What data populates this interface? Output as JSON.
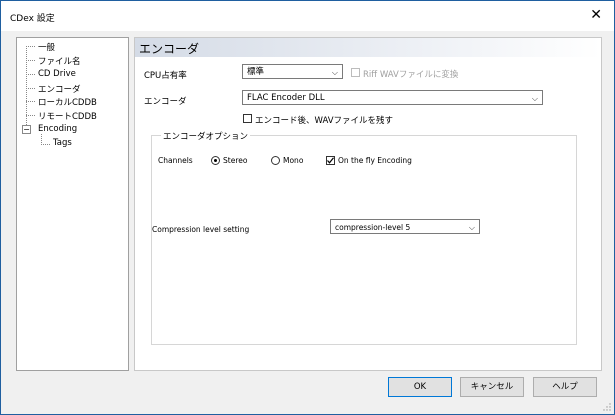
{
  "window": {
    "title": "CDex 設定",
    "close_glyph": "✕"
  },
  "tree": {
    "items": [
      "一般",
      "ファイル名",
      "CD Drive",
      "エンコーダ",
      "ローカルCDDB",
      "リモートCDDB",
      "Encoding"
    ],
    "children": [
      "Tags"
    ],
    "expander": "−"
  },
  "panel": {
    "title": "エンコーダ",
    "cpu_label": "CPU占有率",
    "cpu_value": "標準",
    "riff_label": "Riff WAVファイルに変換",
    "encoder_label": "エンコーダ",
    "encoder_value": "FLAC Encoder DLL",
    "keep_wav_label": "エンコード後、WAVファイルを残す",
    "options_group": "エンコーダオプション",
    "channels_label": "Channels",
    "stereo_label": "Stereo",
    "mono_label": "Mono",
    "onthefly_label": "On the fly Encoding",
    "compression_label": "Compression level setting",
    "compression_value": "compression-level 5"
  },
  "buttons": {
    "ok": "OK",
    "cancel": "キャンセル",
    "help": "ヘルプ"
  },
  "state": {
    "riff_checked": false,
    "riff_enabled": false,
    "keep_wav_checked": false,
    "channel_selected": "Stereo",
    "onthefly_checked": true
  },
  "icons": {
    "dropdown": "chevron-down-icon",
    "check": "checkmark-icon"
  }
}
